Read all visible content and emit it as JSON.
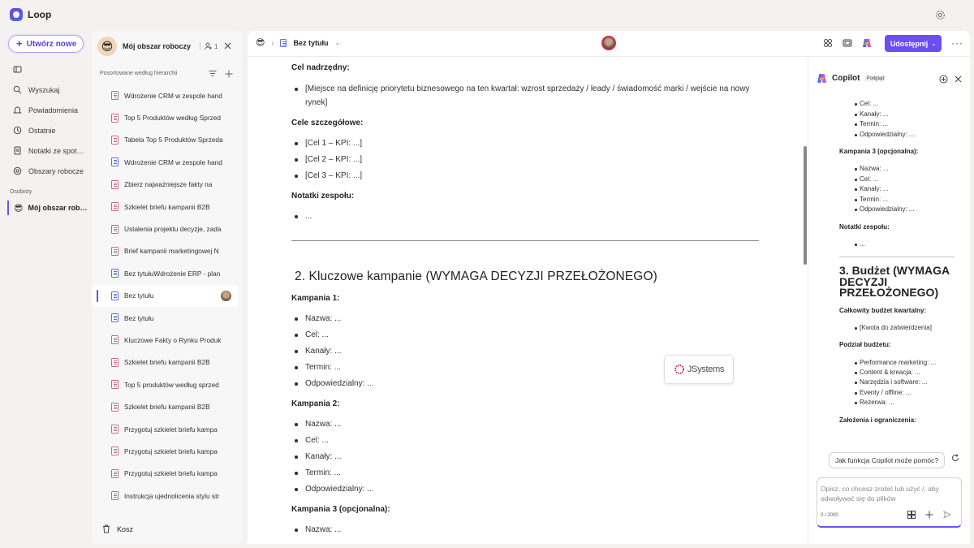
{
  "app": {
    "name": "Loop"
  },
  "rail": {
    "create_label": "Utwórz nowe",
    "nav": [
      {
        "label": "",
        "icon": "home-icon"
      },
      {
        "label": "Wyszukaj",
        "icon": "search-icon"
      },
      {
        "label": "Powiadomienia",
        "icon": "bell-icon"
      },
      {
        "label": "Ostatnie",
        "icon": "clock-icon"
      },
      {
        "label": "Notatki ze spot…",
        "icon": "notes-icon"
      },
      {
        "label": "Obszary robocze",
        "icon": "workspaces-icon"
      }
    ],
    "section_label": "Osobisty",
    "workspace_item": "Mój obszar rob…"
  },
  "sidebar": {
    "workspace_name": "Mój obszar roboczy",
    "member_count": "1",
    "sort_label": "Posortowane według hierarchii",
    "pages": [
      {
        "label": "Wdrożenie CRM w zespole hand",
        "color": "pink"
      },
      {
        "label": "Top 5 Produktów według Sprzed",
        "color": "pink"
      },
      {
        "label": "Tabela Top 5 Produktów Sprzeda",
        "color": "pink"
      },
      {
        "label": "Wdrożenie CRM w zespole hand",
        "color": "blue"
      },
      {
        "label": "Zbierz najważniejsze fakty na",
        "color": "pink"
      },
      {
        "label": "Szkielet briefu kampanii B2B",
        "color": "pink"
      },
      {
        "label": "Ustalenia projektu decyzje, zada",
        "color": "pink"
      },
      {
        "label": "Brief kampanii marketingowej N",
        "color": "pink"
      },
      {
        "label": "Bez tytułuWdrożenie ERP - plan",
        "color": "blue"
      },
      {
        "label": "Bez tytułu",
        "color": "blue",
        "selected": true
      },
      {
        "label": "Bez tytułu",
        "color": "blue"
      },
      {
        "label": "Kluczowe Fakty o Rynku Produk",
        "color": "pink"
      },
      {
        "label": "Szkielet briefu kampanii B2B",
        "color": "pink"
      },
      {
        "label": "Top 5 produktów według sprzed",
        "color": "pink"
      },
      {
        "label": "Szkielet briefu kampanii B2B",
        "color": "pink"
      },
      {
        "label": "Przygotuj szkielet briefu kampa",
        "color": "pink"
      },
      {
        "label": "Przygotuj szkielet briefu kampa",
        "color": "pink"
      },
      {
        "label": "Przygotuj szkielet briefu kampa",
        "color": "pink"
      },
      {
        "label": "Instrukcja ujednolicenia stylu str",
        "color": "pink"
      }
    ],
    "trash_label": "Kosz"
  },
  "topbar": {
    "page_title": "Bez tytułu",
    "share_label": "Udostępnij"
  },
  "document": {
    "h_cel_nadrzedny": "Cel nadrzędny:",
    "cel_nadrzedny_text": "[Miejsce na definicję priorytetu biznesowego na ten kwartał: wzrost sprzedaży / leady / świadomość marki / wejście na nowy rynek]",
    "h_cele_szczegolowe": "Cele szczegółowe:",
    "cele": [
      "[Cel 1 – KPI: ...]",
      "[Cel 2 – KPI: ...]",
      "[Cel 3 – KPI: ...]"
    ],
    "h_notatki": "Notatki zespołu:",
    "notatki_item": "...",
    "section2_title": "2. Kluczowe kampanie (WYMAGA DECYZJI PRZEŁOŻONEGO)",
    "kampania1_title": "Kampania 1:",
    "kampania1_items": [
      "Nazwa: ...",
      "Cel: ...",
      "Kanały: ...",
      "Termin: ...",
      "Odpowiedzialny: ..."
    ],
    "kampania2_title": "Kampania 2:",
    "kampania2_items": [
      "Nazwa: ...",
      "Cel: ...",
      "Kanały: ...",
      "Termin: ...",
      "Odpowiedzialny: ..."
    ],
    "kampania3_title": "Kampania 3 (opcjonalna):",
    "kampania3_items": [
      "Nazwa: ..."
    ],
    "watermark": "JSystems"
  },
  "copilot": {
    "title": "Copilot",
    "badge": "Podgląd",
    "top_items": [
      "Cel: ...",
      "Kanały: ...",
      "Termin: ...",
      "Odpowiedzialny: ..."
    ],
    "k3_title": "Kampania 3 (opcjonalna):",
    "k3_items": [
      "Nazwa: ...",
      "Cel: ...",
      "Kanały: ...",
      "Termin: ...",
      "Odpowiedzialny: ..."
    ],
    "notes_title": "Notatki zespołu:",
    "notes_item": "...",
    "budget_title": "3. Budżet (WYMAGA DECYZJI PRZEŁOŻONEGO)",
    "total_title": "Całkowity budżet kwartalny:",
    "total_item": "[Kwota do zatwierdzenia]",
    "split_title": "Podział budżetu:",
    "split_items": [
      "Performance marketing: ...",
      "Content & kreacja: ...",
      "Narzędzia i software: ...",
      "Eventy / offline: ...",
      "Rezerwa: ..."
    ],
    "assumptions_title": "Założenia i ograniczenia:",
    "suggestion": "Jak funkcja Copilot może pomóc?",
    "input_placeholder": "Opisz, co chcesz zrobić lub użyć /, aby odwoływać się do plików",
    "char_count": "0 / 2000"
  },
  "colors": {
    "accent": "#6b4ff0",
    "background": "#f3f2f1"
  }
}
